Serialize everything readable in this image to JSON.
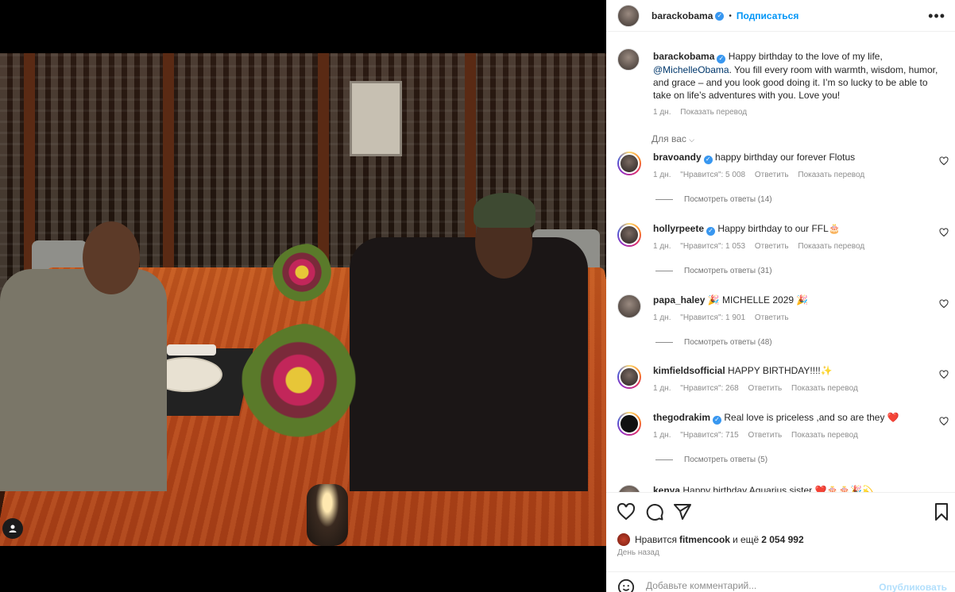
{
  "post": {
    "author": "barackobama",
    "follow_label": "Подписаться",
    "separator": "•",
    "caption_author": "barackobama",
    "caption_pre": "Happy birthday to the love of my life, ",
    "caption_mention": "@MichelleObama",
    "caption_post": ". You fill every room with warmth, wisdom, humor, and grace – and you look good doing it. I’m so lucky to be able to take on life’s adventures with you. Love you!",
    "caption_time": "1 дн.",
    "caption_translate": "Показать перевод",
    "for_you": "Для вас"
  },
  "comments": [
    {
      "user": "bravoandy",
      "verified": true,
      "text": "happy birthday our forever Flotus",
      "time": "1 дн.",
      "likes": "\"Нравится\": 5 008",
      "reply": "Ответить",
      "translate": "Показать перевод",
      "replies": "Посмотреть ответы (14)"
    },
    {
      "user": "hollyrpeete",
      "verified": true,
      "text": "Happy birthday to our FFL🎂",
      "time": "1 дн.",
      "likes": "\"Нравится\": 1 053",
      "reply": "Ответить",
      "translate": "Показать перевод",
      "replies": "Посмотреть ответы (31)"
    },
    {
      "user": "papa_haley",
      "verified": false,
      "text": "🎉 MICHELLE 2029 🎉",
      "time": "1 дн.",
      "likes": "\"Нравится\": 1 901",
      "reply": "Ответить",
      "translate": "",
      "replies": "Посмотреть ответы (48)"
    },
    {
      "user": "kimfieldsofficial",
      "verified": false,
      "text": "HAPPY BIRTHDAY!!!!✨",
      "time": "1 дн.",
      "likes": "\"Нравится\": 268",
      "reply": "Ответить",
      "translate": "Показать перевод",
      "replies": ""
    },
    {
      "user": "thegodrakim",
      "verified": true,
      "text": "Real love is priceless ,and so are they ❤️",
      "time": "1 дн.",
      "likes": "\"Нравится\": 715",
      "reply": "Ответить",
      "translate": "Показать перевод",
      "replies": "Посмотреть ответы (5)"
    },
    {
      "user": "kenya",
      "verified": false,
      "text": "Happy birthday Aquarius sister ❤️🎂🎂🎉💫",
      "time": "",
      "likes": "",
      "reply": "",
      "translate": "",
      "replies": ""
    }
  ],
  "likes_bar": {
    "prefix": "Нравится",
    "user": "fitmencook",
    "suffix": "и ещё",
    "count": "2 054 992",
    "time_ago": "День назад"
  },
  "add_comment": {
    "placeholder": "Добавьте комментарий...",
    "publish": "Опубликовать"
  },
  "icons": [
    "user-tag-icon",
    "heart-icon",
    "comment-icon",
    "share-icon",
    "bookmark-icon",
    "emoji-icon",
    "more-icon",
    "verified-icon"
  ],
  "colors": {
    "accent": "#0095f6",
    "verified": "#3897f0",
    "muted": "#8e8e8e"
  }
}
